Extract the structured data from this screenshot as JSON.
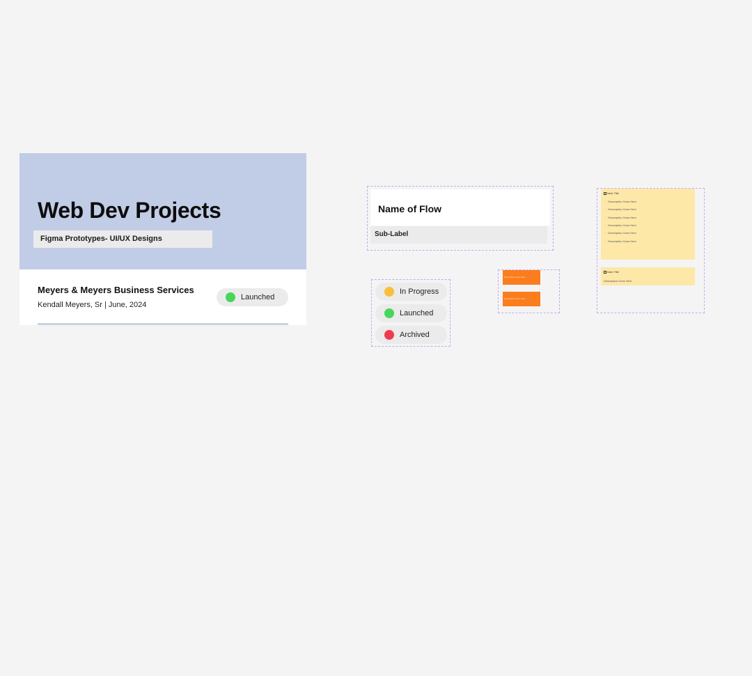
{
  "project_card": {
    "title": "Web Dev Projects",
    "subtitle": "Figma Prototypes- UI/UX Designs",
    "client_name": "Meyers & Meyers Business Services",
    "client_meta": "Kendall Meyers, Sr | June, 2024",
    "status": {
      "label": "Launched",
      "color": "#47d65a"
    },
    "header_color": "#c1cce6"
  },
  "flow": {
    "name": "Name of Flow",
    "sub_label": "Sub-Label"
  },
  "statuses": [
    {
      "label": "In Progress",
      "color": "#f8bf3c"
    },
    {
      "label": "Launched",
      "color": "#47d65a"
    },
    {
      "label": "Archived",
      "color": "#ef3b4f"
    }
  ],
  "orange_tags": [
    {
      "text": "Description Goes Here"
    },
    {
      "text": "Description Goes Here"
    }
  ],
  "notes": {
    "note_1": {
      "title": "Note Title",
      "lines": [
        "Description Goes Here",
        "Description Goes Here",
        "Description Goes Here",
        "Description Goes Here",
        "Description Goes Here",
        "Description Goes Here"
      ]
    },
    "note_2": {
      "title": "Note Title",
      "description": "Description Goes Here"
    }
  },
  "colors": {
    "canvas": "#f4f4f4",
    "selection_dash": "#c9a8e8",
    "sticky_orange": "#fb7d1e",
    "sticky_yellow": "#fde8a8"
  }
}
